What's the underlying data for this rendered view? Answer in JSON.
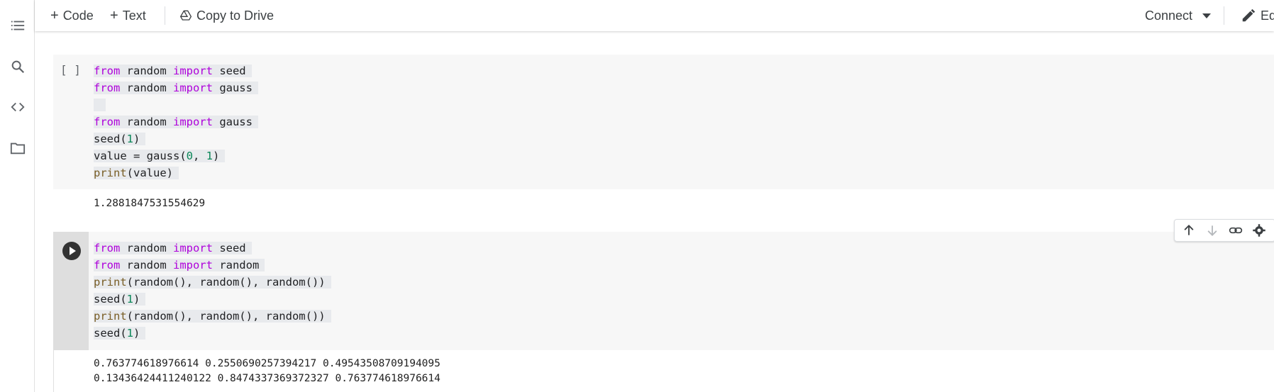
{
  "toolbar": {
    "code_label": "Code",
    "text_label": "Text",
    "copy_to_drive_label": "Copy to Drive",
    "connect_label": "Connect",
    "edit_label": "Ed"
  },
  "sidebar": {
    "icons": [
      "table-of-contents-icon",
      "search-icon",
      "code-snippets-icon",
      "files-icon"
    ]
  },
  "cells": [
    {
      "bracket": "[ ]",
      "lines": [
        "from random import seed",
        "from random import gauss",
        "",
        "from random import gauss",
        "seed(1)",
        "value = gauss(0, 1)",
        "print(value)"
      ],
      "output": [
        "1.2881847531554629"
      ]
    },
    {
      "lines": [
        "from random import seed",
        "from random import random",
        "print(random(), random(), random())",
        "seed(1)",
        "print(random(), random(), random())",
        "seed(1)"
      ],
      "output": [
        "0.763774618976614 0.2550690257394217 0.49543508709194095",
        "0.13436424411240122 0.8474337369372327 0.763774618976614"
      ]
    }
  ]
}
